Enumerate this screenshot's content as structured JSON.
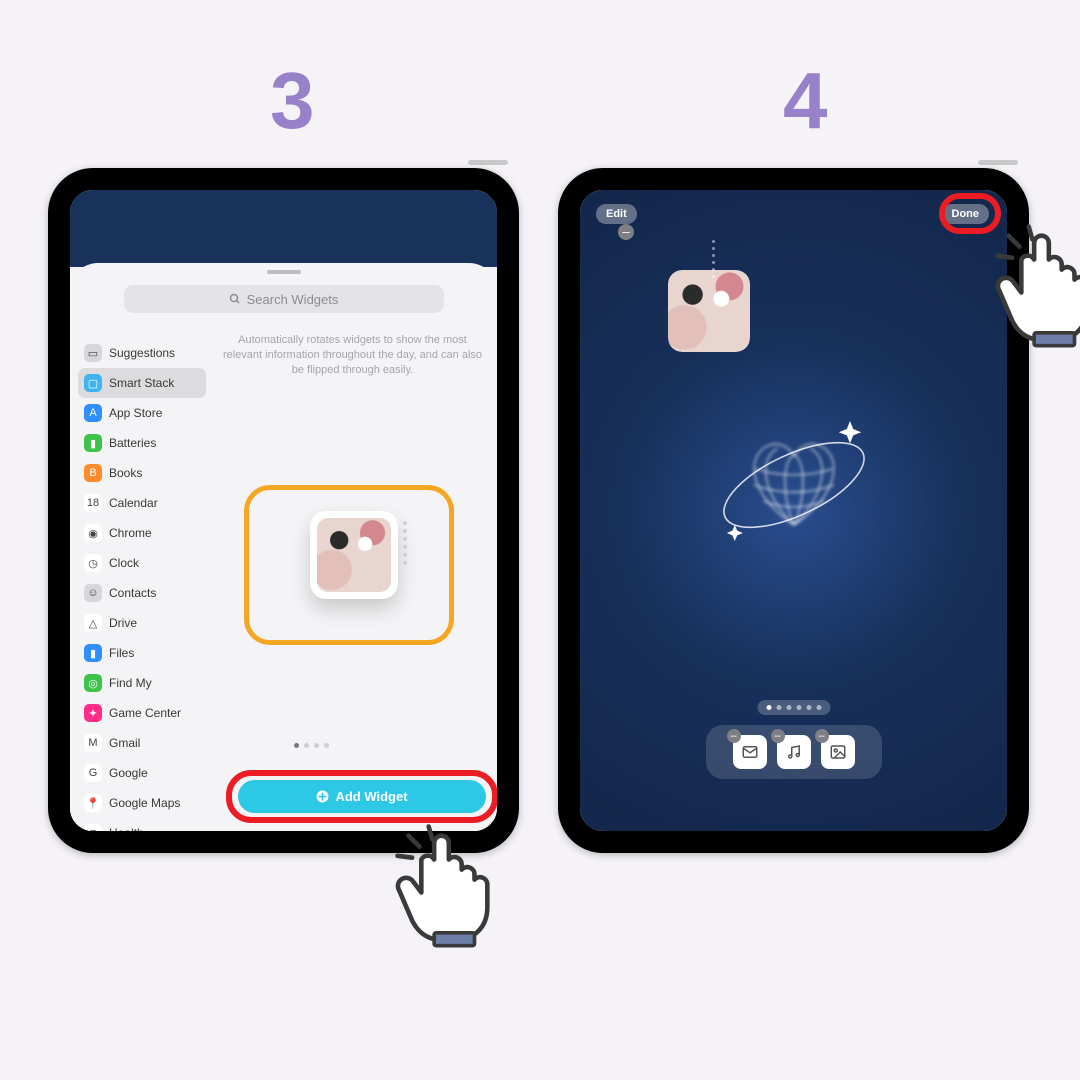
{
  "steps": {
    "left": "3",
    "right": "4"
  },
  "left": {
    "search_placeholder": "Search Widgets",
    "description": "Automatically rotates widgets to show the most relevant information throughout the day, and can also be flipped through easily.",
    "sidebar": [
      {
        "label": "Suggestions",
        "color": "#d7d7db",
        "glyph": "▭"
      },
      {
        "label": "Smart Stack",
        "color": "#3fb4f0",
        "glyph": "▢"
      },
      {
        "label": "App Store",
        "color": "#2f8fff",
        "glyph": "A"
      },
      {
        "label": "Batteries",
        "color": "#3fc24b",
        "glyph": "▮"
      },
      {
        "label": "Books",
        "color": "#ff8a2a",
        "glyph": "B"
      },
      {
        "label": "Calendar",
        "color": "#ffffff",
        "glyph": "18"
      },
      {
        "label": "Chrome",
        "color": "#ffffff",
        "glyph": "◉"
      },
      {
        "label": "Clock",
        "color": "#ffffff",
        "glyph": "◷"
      },
      {
        "label": "Contacts",
        "color": "#d7d7db",
        "glyph": "☺"
      },
      {
        "label": "Drive",
        "color": "#ffffff",
        "glyph": "△"
      },
      {
        "label": "Files",
        "color": "#2f8fff",
        "glyph": "▮"
      },
      {
        "label": "Find My",
        "color": "#3fc24b",
        "glyph": "◎"
      },
      {
        "label": "Game Center",
        "color": "#ff2d88",
        "glyph": "✦"
      },
      {
        "label": "Gmail",
        "color": "#ffffff",
        "glyph": "M"
      },
      {
        "label": "Google",
        "color": "#ffffff",
        "glyph": "G"
      },
      {
        "label": "Google Maps",
        "color": "#ffffff",
        "glyph": "📍"
      },
      {
        "label": "Health",
        "color": "#ffffff",
        "glyph": "♥"
      }
    ],
    "selected_index": 1,
    "add_button": "Add Widget",
    "page_dots": 4,
    "page_current": 0
  },
  "right": {
    "edit_label": "Edit",
    "done_label": "Done",
    "dock_apps": [
      "mail-icon",
      "music-icon",
      "photos-icon"
    ],
    "page_dots": 6,
    "page_current": 0
  },
  "colors": {
    "accent_purple": "#9781c9",
    "highlight_orange": "#f5a623",
    "highlight_red": "#ec1c24",
    "button_cyan": "#2cc8e6"
  }
}
